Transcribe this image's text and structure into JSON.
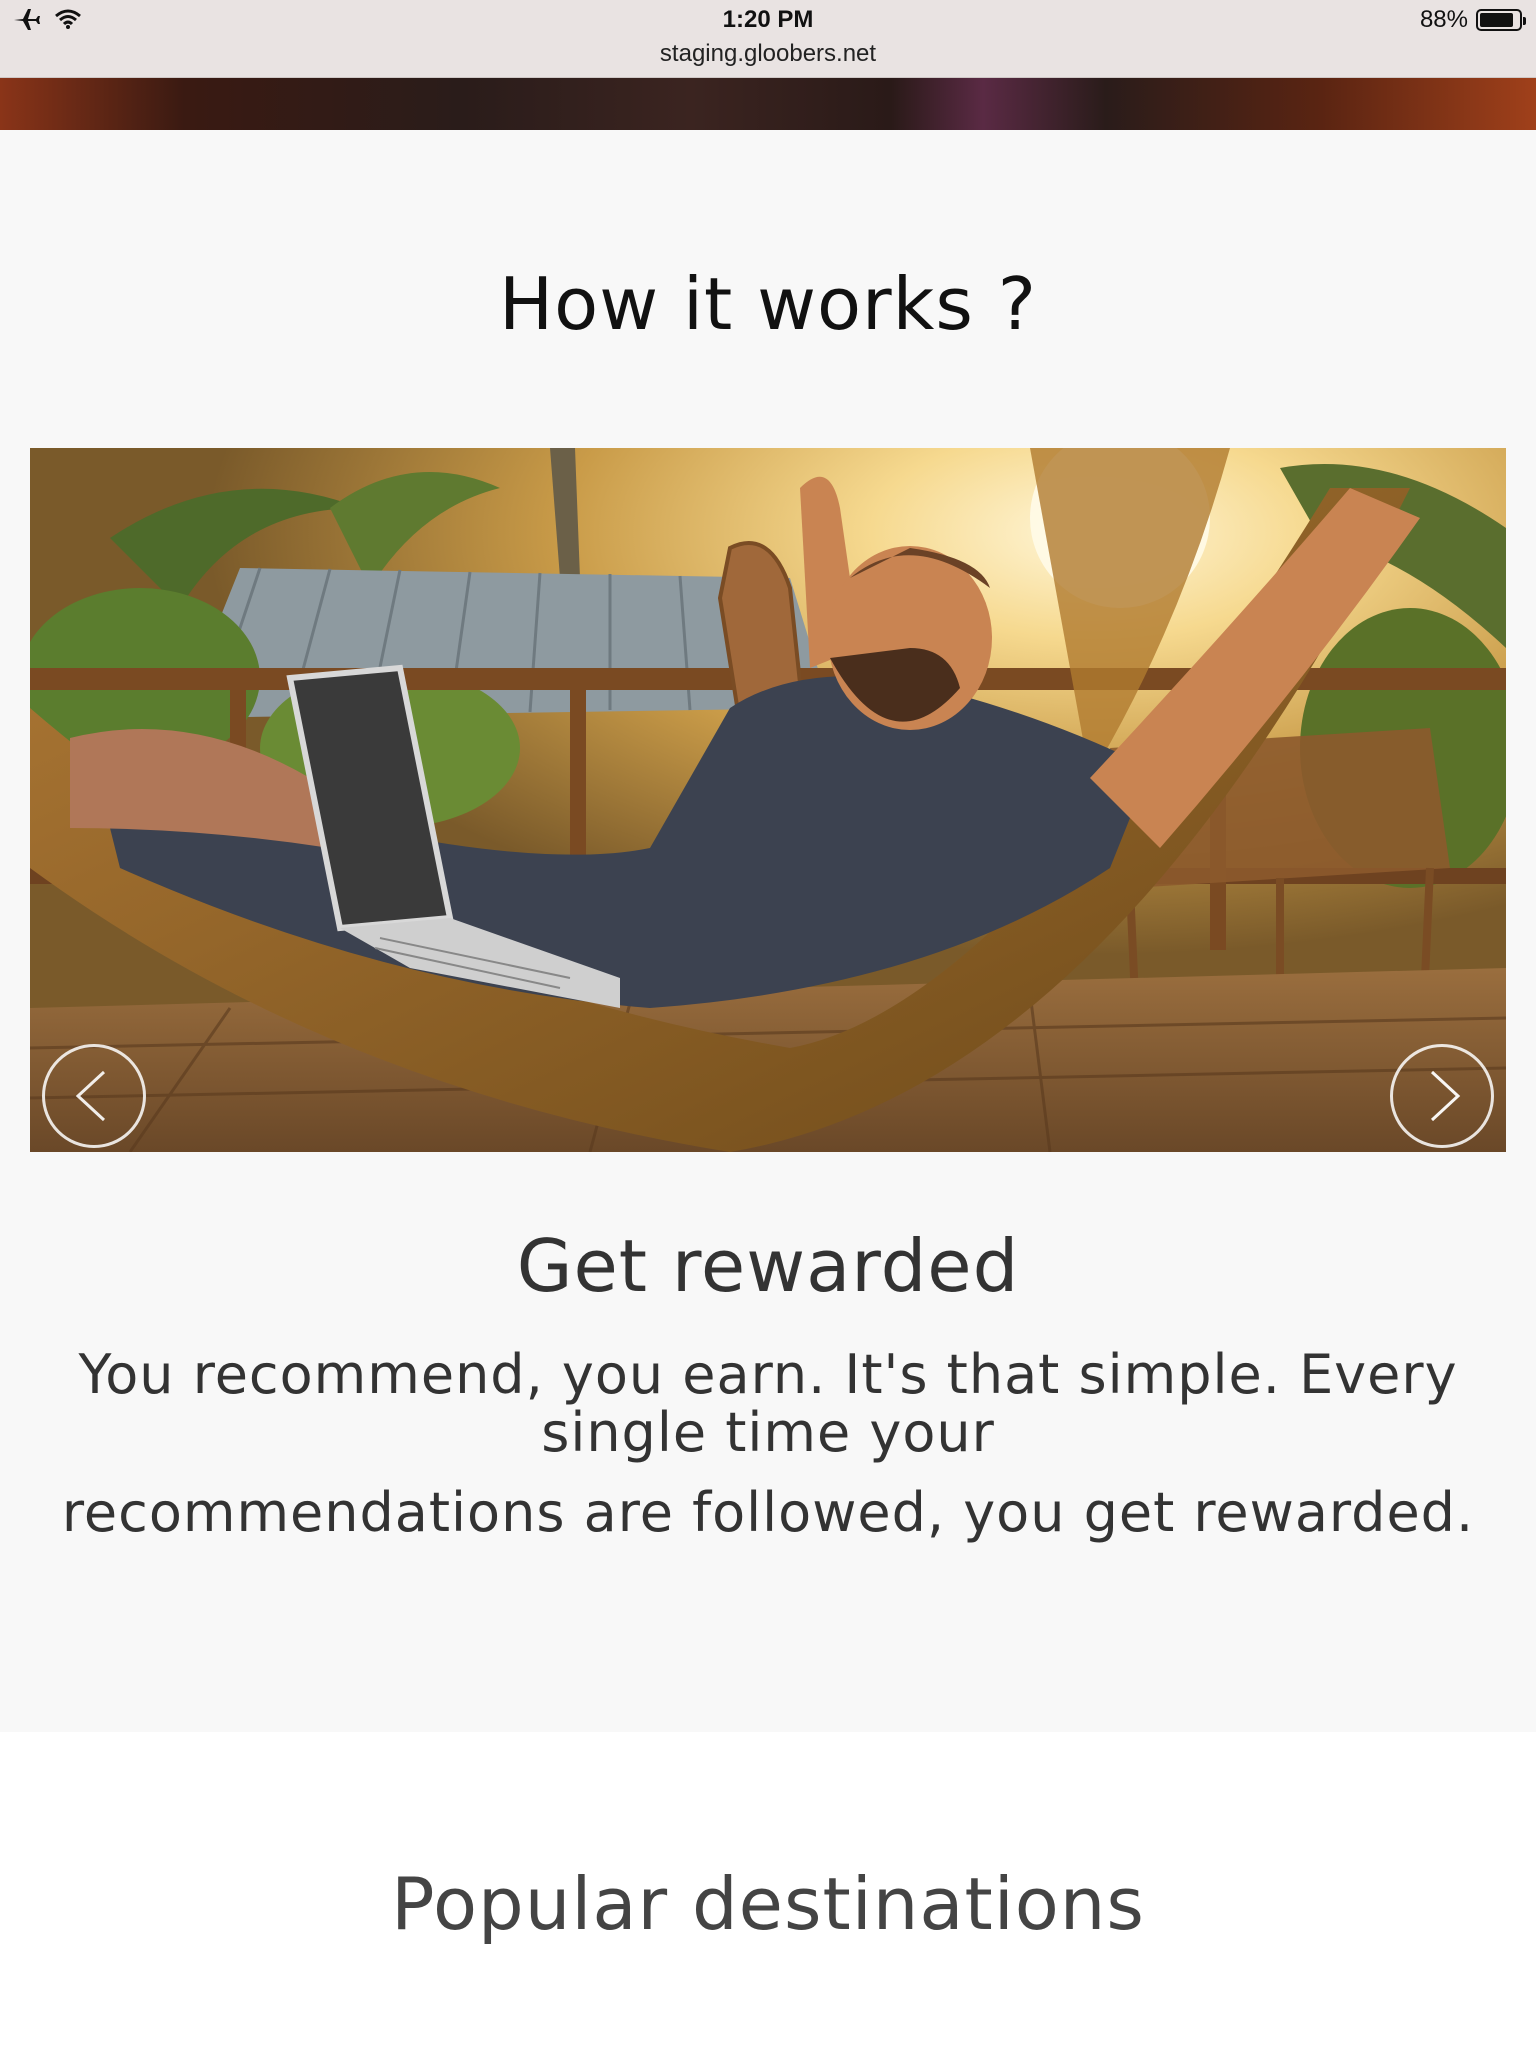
{
  "status_bar": {
    "time": "1:20 PM",
    "url": "staging.gloobers.net",
    "battery": "88%",
    "battery_level": 0.88,
    "icons": [
      "airplane-mode-icon",
      "wifi-icon",
      "battery-icon"
    ]
  },
  "how_it_works": {
    "title": "How it works ?",
    "slide": {
      "image_subject": "man-in-hammock-with-laptop",
      "title": "Get rewarded",
      "text_line1": "You recommend, you earn. It's that simple. Every single time your",
      "text_line2": "recommendations are followed, you get rewarded."
    },
    "prev_icon": "chevron-left-icon",
    "next_icon": "chevron-right-icon"
  },
  "popular": {
    "title": "Popular destinations"
  },
  "colors": {
    "section_bg": "#f8f8f8",
    "popular_bg": "#ffffff",
    "heading_text": "#333333"
  }
}
